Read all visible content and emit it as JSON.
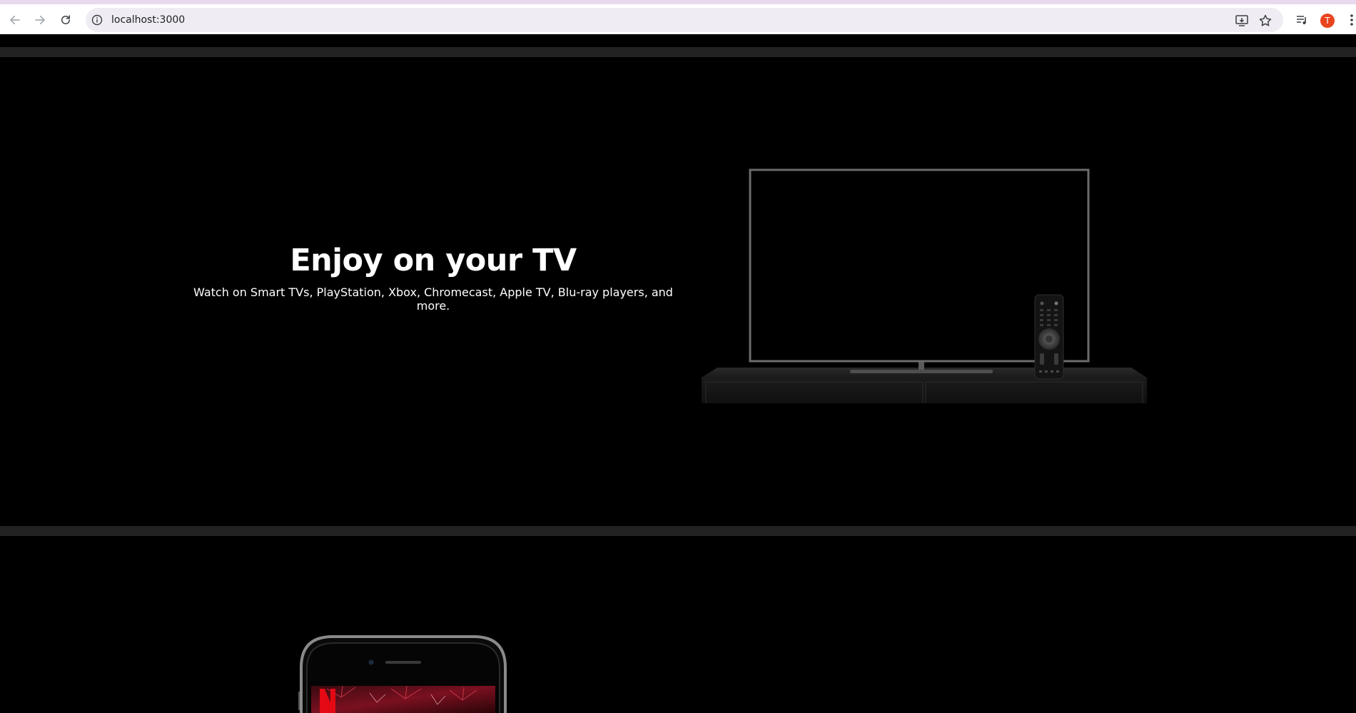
{
  "browser": {
    "url": "localhost:3000",
    "avatar_initial": "T",
    "icons": [
      "back-icon",
      "forward-icon",
      "reload-icon",
      "site-info-icon",
      "install-app-icon",
      "bookmark-star-icon",
      "media-controls-icon",
      "profile-avatar",
      "menu-dots-icon"
    ]
  },
  "tv_section": {
    "title": "Enjoy on your TV",
    "subtitle": "Watch on Smart TVs, PlayStation, Xbox, Chromecast, Apple TV, Blu-ray players, and more."
  },
  "colors": {
    "background": "#000000",
    "divider": "#222222",
    "text": "#ffffff",
    "avatar": "#e8451e",
    "brand_red": "#e50914"
  }
}
